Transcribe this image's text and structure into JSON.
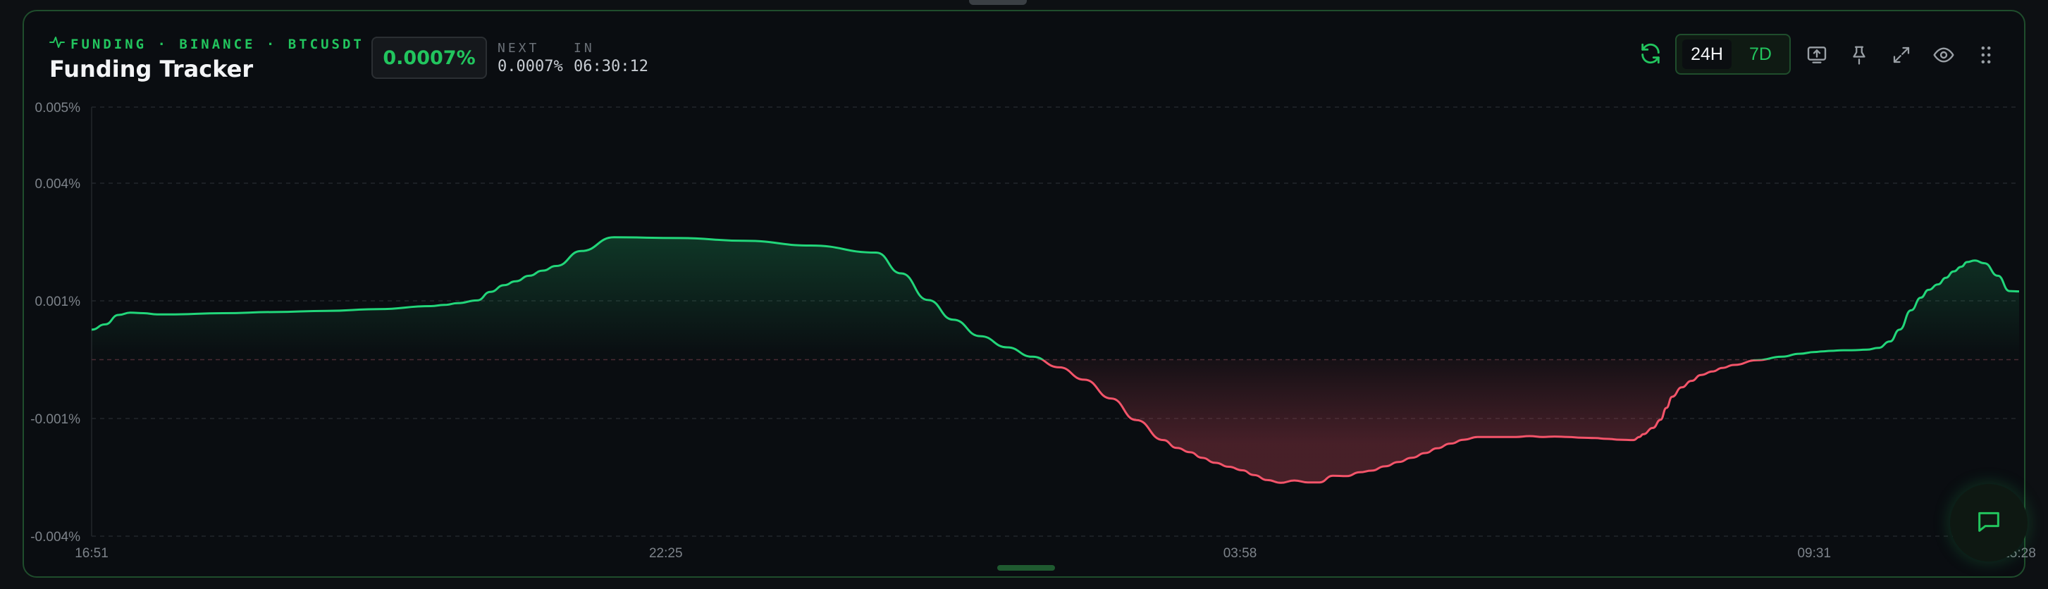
{
  "header": {
    "eyebrow": "FUNDING · BINANCE · BTCUSDT",
    "title": "Funding Tracker",
    "current_rate": "0.0007%",
    "next_label": "NEXT",
    "next_value": "0.0007%",
    "in_label": "IN",
    "countdown": "06:30:12"
  },
  "toolbar": {
    "range_options": [
      "24H",
      "7D"
    ],
    "selected_range": "24H",
    "icons": [
      "refresh-icon",
      "upload-icon",
      "pin-icon",
      "expand-icon",
      "eye-icon",
      "drag-handle-icon"
    ]
  },
  "colors": {
    "accent": "#22c55e",
    "positive_line": "#22d67a",
    "negative_line": "#f4546a",
    "border": "#1f4d2c"
  },
  "chart_data": {
    "type": "area",
    "title": "",
    "xlabel": "",
    "ylabel": "",
    "baseline": 0.0,
    "ylim": [
      -0.004,
      0.005
    ],
    "y_ticks": [
      "0.005%",
      "0.004%",
      "0.001%",
      "-0.001%",
      "-0.004%"
    ],
    "y_tick_values": [
      0.005,
      0.004,
      0.001,
      -0.001,
      -0.004
    ],
    "x_range": [
      0,
      100
    ],
    "x_ticks": [
      "16:51",
      "22:25",
      "03:58",
      "09:31",
      "15:28"
    ],
    "x_tick_values": [
      0,
      29.79,
      59.58,
      89.37,
      100
    ],
    "grid": true,
    "series": [
      {
        "x": [
          0,
          0.7,
          1.4,
          2.0,
          2.7,
          3.4,
          4.1,
          6.8,
          9.5,
          12.2,
          14.9,
          17.6,
          18.3,
          19.0,
          20.0,
          20.7,
          21.4,
          22.0,
          22.7,
          23.4,
          24.1,
          25.4,
          27.1,
          30.5,
          33.9,
          37.3,
          40.7,
          42.0,
          43.4,
          44.7,
          46.1,
          47.5,
          48.8,
          50.2,
          51.5,
          52.9,
          54.2,
          55.6,
          56.3,
          57.0,
          57.6,
          58.3,
          59.0,
          59.7,
          60.3,
          61.0,
          61.7,
          62.4,
          63.1,
          63.7,
          64.4,
          65.1,
          65.8,
          66.4,
          67.1,
          67.8,
          68.5,
          69.2,
          69.8,
          70.5,
          71.2,
          71.9,
          72.5,
          73.2,
          73.9,
          74.6,
          75.3,
          75.9,
          76.6,
          77.3,
          78.0,
          78.6,
          79.3,
          80.0,
          80.3,
          80.5,
          81.0,
          81.4,
          81.7,
          82.0,
          82.5,
          83.0,
          83.5,
          84.1,
          84.6,
          85.2,
          86.4,
          87.7,
          88.6,
          89.4,
          89.8,
          90.2,
          90.9,
          91.3,
          92.1,
          92.7,
          93.3,
          93.8,
          94.4,
          94.9,
          95.3,
          95.8,
          96.2,
          96.6,
          97.0,
          97.3,
          97.7,
          98.2,
          98.9,
          99.5,
          100
        ],
        "y": [
          0.00051,
          0.0006,
          0.00076,
          0.0008,
          0.00079,
          0.00077,
          0.00077,
          0.00079,
          0.00081,
          0.00083,
          0.00086,
          0.00091,
          0.00093,
          0.00096,
          0.00101,
          0.00123,
          0.0014,
          0.0015,
          0.00164,
          0.00177,
          0.00189,
          0.00227,
          0.00262,
          0.0026,
          0.00253,
          0.00241,
          0.00223,
          0.0017,
          0.00102,
          0.00068,
          0.0004,
          0.00021,
          5e-05,
          -0.00013,
          -0.00034,
          -0.00066,
          -0.00104,
          -0.00155,
          -0.00175,
          -0.00186,
          -0.002,
          -0.00213,
          -0.00223,
          -0.00232,
          -0.00244,
          -0.00257,
          -0.00264,
          -0.00258,
          -0.00263,
          -0.00263,
          -0.00246,
          -0.00247,
          -0.00237,
          -0.00233,
          -0.00222,
          -0.00211,
          -0.002,
          -0.00188,
          -0.00176,
          -0.00164,
          -0.00154,
          -0.00147,
          -0.00147,
          -0.00147,
          -0.00147,
          -0.00145,
          -0.00147,
          -0.00146,
          -0.00147,
          -0.00149,
          -0.0015,
          -0.00152,
          -0.00154,
          -0.00155,
          -0.00147,
          -0.0014,
          -0.00124,
          -0.00103,
          -0.00082,
          -0.00063,
          -0.00047,
          -0.00036,
          -0.00026,
          -0.0002,
          -0.00014,
          -9e-05,
          -1e-05,
          5e-05,
          0.0001,
          0.00013,
          0.00014,
          0.00015,
          0.00016,
          0.00016,
          0.00017,
          0.0002,
          0.00031,
          0.00051,
          0.00084,
          0.00108,
          0.00128,
          0.00142,
          0.00159,
          0.00175,
          0.00187,
          0.00199,
          0.00203,
          0.00196,
          0.00164,
          0.00125,
          0.00124
        ]
      }
    ]
  },
  "chat": {
    "icon": "chat-icon"
  }
}
